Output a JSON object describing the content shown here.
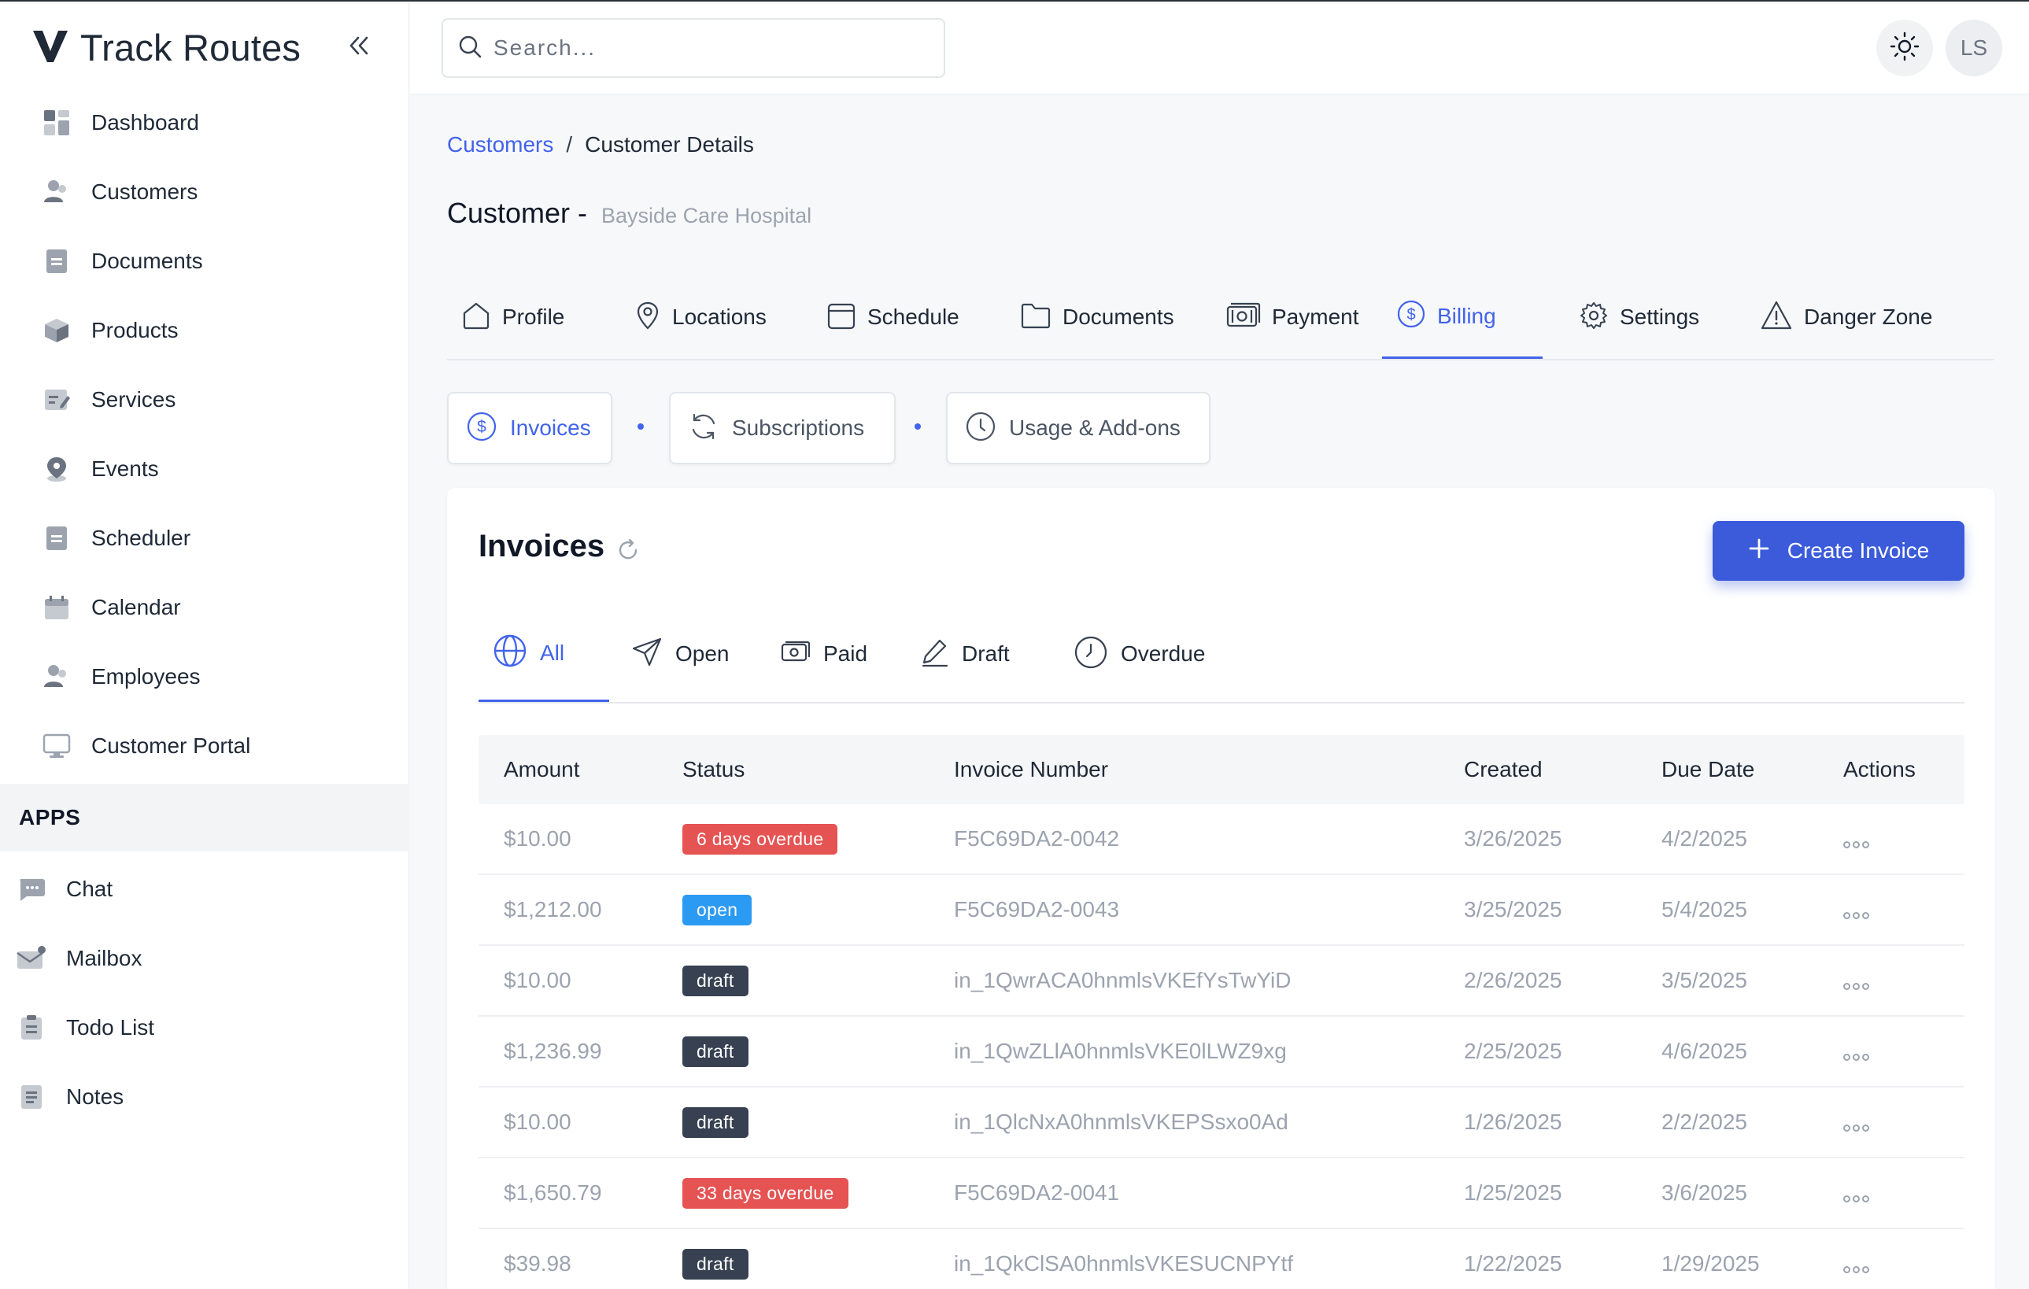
{
  "app": {
    "name": "Track Routes"
  },
  "sidebar": {
    "items": [
      {
        "label": "Dashboard",
        "icon": "dashboard-icon"
      },
      {
        "label": "Customers",
        "icon": "users-icon"
      },
      {
        "label": "Documents",
        "icon": "document-icon"
      },
      {
        "label": "Products",
        "icon": "box-icon"
      },
      {
        "label": "Services",
        "icon": "edit-card-icon"
      },
      {
        "label": "Events",
        "icon": "map-pin-icon"
      },
      {
        "label": "Scheduler",
        "icon": "document-icon"
      },
      {
        "label": "Calendar",
        "icon": "calendar-icon"
      },
      {
        "label": "Employees",
        "icon": "users-icon"
      },
      {
        "label": "Customer Portal",
        "icon": "monitor-icon"
      }
    ],
    "apps_header": "APPS",
    "apps": [
      {
        "label": "Chat",
        "icon": "chat-icon"
      },
      {
        "label": "Mailbox",
        "icon": "mail-icon"
      },
      {
        "label": "Todo List",
        "icon": "clipboard-icon"
      },
      {
        "label": "Notes",
        "icon": "notes-icon"
      }
    ]
  },
  "header": {
    "search_placeholder": "Search...",
    "avatar_initials": "LS"
  },
  "breadcrumb": {
    "parent": "Customers",
    "separator": "/",
    "current": "Customer Details"
  },
  "page": {
    "title": "Customer -",
    "customer_name": "Bayside Care Hospital"
  },
  "tabs": [
    {
      "label": "Profile",
      "icon": "home-icon"
    },
    {
      "label": "Locations",
      "icon": "map-pin-icon"
    },
    {
      "label": "Schedule",
      "icon": "calendar-icon"
    },
    {
      "label": "Documents",
      "icon": "folder-icon"
    },
    {
      "label": "Payment",
      "icon": "cash-icon"
    },
    {
      "label": "Billing",
      "icon": "dollar-circle-icon",
      "active": true
    },
    {
      "label": "Settings",
      "icon": "gear-icon"
    },
    {
      "label": "Danger Zone",
      "icon": "warning-icon"
    }
  ],
  "subtabs": [
    {
      "label": "Invoices",
      "icon": "dollar-circle-icon",
      "active": true
    },
    {
      "label": "Subscriptions",
      "icon": "refresh-icon"
    },
    {
      "label": "Usage & Add-ons",
      "icon": "clock-icon"
    }
  ],
  "invoices": {
    "title": "Invoices",
    "create_label": "Create Invoice",
    "filters": [
      {
        "label": "All",
        "icon": "globe-icon",
        "active": true
      },
      {
        "label": "Open",
        "icon": "send-icon"
      },
      {
        "label": "Paid",
        "icon": "cash-icon"
      },
      {
        "label": "Draft",
        "icon": "pencil-icon"
      },
      {
        "label": "Overdue",
        "icon": "clock-icon"
      }
    ],
    "columns": {
      "amount": "Amount",
      "status": "Status",
      "invoice_number": "Invoice Number",
      "created": "Created",
      "due_date": "Due Date",
      "actions": "Actions"
    },
    "rows": [
      {
        "amount": "$10.00",
        "status": "6 days overdue",
        "status_kind": "overdue",
        "invoice_number": "F5C69DA2-0042",
        "created": "3/26/2025",
        "due_date": "4/2/2025"
      },
      {
        "amount": "$1,212.00",
        "status": "open",
        "status_kind": "open",
        "invoice_number": "F5C69DA2-0043",
        "created": "3/25/2025",
        "due_date": "5/4/2025"
      },
      {
        "amount": "$10.00",
        "status": "draft",
        "status_kind": "draft",
        "invoice_number": "in_1QwrACA0hnmlsVKEfYsTwYiD",
        "created": "2/26/2025",
        "due_date": "3/5/2025"
      },
      {
        "amount": "$1,236.99",
        "status": "draft",
        "status_kind": "draft",
        "invoice_number": "in_1QwZLlA0hnmlsVKE0lLWZ9xg",
        "created": "2/25/2025",
        "due_date": "4/6/2025"
      },
      {
        "amount": "$10.00",
        "status": "draft",
        "status_kind": "draft",
        "invoice_number": "in_1QlcNxA0hnmlsVKEPSsxo0Ad",
        "created": "1/26/2025",
        "due_date": "2/2/2025"
      },
      {
        "amount": "$1,650.79",
        "status": "33 days overdue",
        "status_kind": "overdue",
        "invoice_number": "F5C69DA2-0041",
        "created": "1/25/2025",
        "due_date": "3/6/2025"
      },
      {
        "amount": "$39.98",
        "status": "draft",
        "status_kind": "draft",
        "invoice_number": "in_1QkClSA0hnmlsVKESUCNPYtf",
        "created": "1/22/2025",
        "due_date": "1/29/2025"
      }
    ]
  },
  "colors": {
    "accent": "#3b5bdb",
    "overdue": "#e55353",
    "open": "#2b9af3",
    "draft": "#374151"
  }
}
